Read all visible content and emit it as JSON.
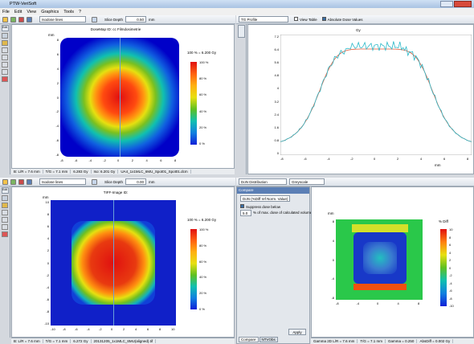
{
  "app": {
    "title": "PTW-VeriSoft"
  },
  "menu": [
    "File",
    "Edit",
    "View",
    "Graphics",
    "Tools",
    "?"
  ],
  "top_left": {
    "tool_combo": "Isodose lines",
    "slice_depth_label": "Slice Depth",
    "slice_depth_value": "0.50",
    "slice_depth_unit": "mm",
    "plot_title": "DoseMap ID: cc Filmdosimetrie",
    "axis_unit": "mm",
    "legend_title": "100 % = 6.200 Gy",
    "legend_ticks": [
      "100 %",
      "80 %",
      "60 %",
      "40 %",
      "20 %",
      "0 %"
    ],
    "x_ticks": [
      "-8",
      "-6",
      "-4",
      "-2",
      "0",
      "2",
      "4",
      "6",
      "8"
    ],
    "y_ticks": [
      "8",
      "6",
      "4",
      "2",
      "0",
      "-2",
      "-4",
      "-6",
      "-8"
    ],
    "status": [
      "B: L/R = 7.6 mm",
      "T/G = 7.1 mm",
      "6.283 Gy",
      "Iso: 6.201 Gy",
      "UA4_1x1MLC_6MU_Spot01_Spot01.dcm"
    ]
  },
  "top_right": {
    "tab": "TG Profile",
    "view_table": "View Table",
    "absolute_dose": "Absolute Dose Values",
    "y_unit": "Gy",
    "y_ticks": [
      "7.2",
      "6.4",
      "5.6",
      "4.8",
      "4",
      "3.2",
      "2.4",
      "1.6",
      "0.8",
      "0"
    ],
    "x_ticks": [
      "-8",
      "-6",
      "-4",
      "-2",
      "0",
      "2",
      "4",
      "6",
      "8"
    ],
    "x_unit": "mm"
  },
  "bottom_left": {
    "tool_combo": "Isodose lines",
    "slice_depth_label": "Slice Depth",
    "slice_depth_value": "0.00",
    "slice_depth_unit": "mm",
    "plot_title": "TIFF-Image ID:",
    "axis_unit": "mm",
    "legend_title": "100 % = 6.200 Gy",
    "legend_ticks": [
      "100 %",
      "80 %",
      "60 %",
      "40 %",
      "20 %",
      "0 %"
    ],
    "x_ticks": [
      "-10",
      "-8",
      "-6",
      "-4",
      "-2",
      "0",
      "2",
      "4",
      "6",
      "8",
      "10"
    ],
    "y_ticks": [
      "10",
      "8",
      "6",
      "4",
      "2",
      "0",
      "-2",
      "-4",
      "-6",
      "-8",
      "-10"
    ],
    "status": [
      "B: L/R = 7.6 mm",
      "T/G = 7.1 mm",
      "6.272 Gy",
      "20131205_1x1MLC_6MU(aligned).tif"
    ]
  },
  "compare": {
    "header": "DoN Distribution",
    "color_combo": "Greyscale",
    "title": "Compare",
    "mode_combo": "DoN (%Diff ref Norm. Value)",
    "suppress_label": "Suppress dose below",
    "threshold_value": "5.0",
    "threshold_text": "% of max. dose of calculated volume",
    "apply_button": "Apply",
    "tabs": [
      "Compare",
      "NTVObs"
    ]
  },
  "bottom_right": {
    "axis_unit": "mm",
    "legend_title": "% Diff",
    "legend_ticks": [
      "10",
      "8",
      "6",
      "4",
      "2",
      "0",
      "-2",
      "-4",
      "-6",
      "-8",
      "-10"
    ],
    "x_ticks": [
      "-8",
      "-4",
      "0",
      "4",
      "8"
    ],
    "y_ticks": [
      "8",
      "4",
      "0",
      "-4",
      "-8"
    ],
    "status": [
      "Gamma 2D L/R = 7.6 mm",
      "T/G = 7.1 mm",
      "Gamma = 0.250",
      "AbsDiff = 0.002 Gy"
    ]
  },
  "colors": {
    "accent": "#3a6ea5",
    "panel_bg": "#d4d8de"
  }
}
